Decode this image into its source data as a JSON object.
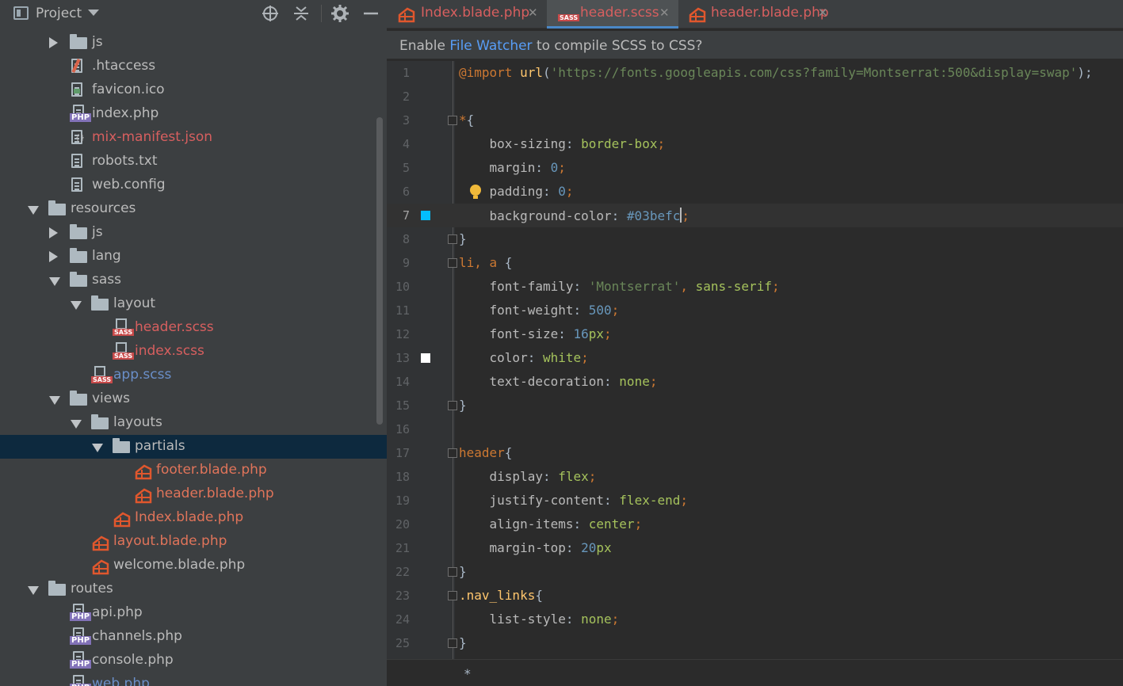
{
  "project_panel": {
    "title": "Project",
    "icons": [
      "window-icon",
      "chevron-down-icon",
      "locate-icon",
      "collapse-all-icon",
      "gear-icon",
      "minimize-icon"
    ],
    "tree": [
      {
        "label": "js",
        "type": "folder",
        "state": "collapsed",
        "color": "normal"
      },
      {
        "label": ".htaccess",
        "type": "file-htaccess",
        "color": "normal"
      },
      {
        "label": "favicon.ico",
        "type": "file-image",
        "color": "normal"
      },
      {
        "label": "index.php",
        "type": "file-php",
        "color": "normal"
      },
      {
        "label": "mix-manifest.json",
        "type": "file-json",
        "color": "red"
      },
      {
        "label": "robots.txt",
        "type": "file-text",
        "color": "normal"
      },
      {
        "label": "web.config",
        "type": "file-text",
        "color": "normal"
      },
      {
        "label": "resources",
        "type": "folder",
        "state": "expanded",
        "color": "normal"
      },
      {
        "label": "js",
        "type": "folder",
        "state": "collapsed",
        "color": "normal"
      },
      {
        "label": "lang",
        "type": "folder",
        "state": "collapsed",
        "color": "normal"
      },
      {
        "label": "sass",
        "type": "folder",
        "state": "expanded",
        "color": "normal"
      },
      {
        "label": "layout",
        "type": "folder",
        "state": "expanded",
        "color": "normal"
      },
      {
        "label": "header.scss",
        "type": "file-sass",
        "color": "red"
      },
      {
        "label": "index.scss",
        "type": "file-sass",
        "color": "red"
      },
      {
        "label": "app.scss",
        "type": "file-sass",
        "color": "blue"
      },
      {
        "label": "views",
        "type": "folder",
        "state": "expanded",
        "color": "normal"
      },
      {
        "label": "layouts",
        "type": "folder",
        "state": "expanded",
        "color": "normal"
      },
      {
        "label": "partials",
        "type": "folder",
        "state": "expanded",
        "color": "normal",
        "selected": true
      },
      {
        "label": "footer.blade.php",
        "type": "file-blade",
        "color": "orange"
      },
      {
        "label": "header.blade.php",
        "type": "file-blade",
        "color": "orange"
      },
      {
        "label": "Index.blade.php",
        "type": "file-blade",
        "color": "orange"
      },
      {
        "label": "layout.blade.php",
        "type": "file-blade",
        "color": "orange"
      },
      {
        "label": "welcome.blade.php",
        "type": "file-blade",
        "color": "normal"
      },
      {
        "label": "routes",
        "type": "folder",
        "state": "expanded",
        "color": "normal"
      },
      {
        "label": "api.php",
        "type": "file-php",
        "color": "normal"
      },
      {
        "label": "channels.php",
        "type": "file-php",
        "color": "normal"
      },
      {
        "label": "console.php",
        "type": "file-php",
        "color": "normal"
      },
      {
        "label": "web.php",
        "type": "file-php",
        "color": "blue"
      }
    ]
  },
  "tabs": [
    {
      "label": "Index.blade.php",
      "icon": "blade-icon",
      "active": false
    },
    {
      "label": "header.scss",
      "icon": "sass-icon",
      "active": true
    },
    {
      "label": "header.blade.php",
      "icon": "blade-icon",
      "active": false
    }
  ],
  "tab_close_glyph": "✕",
  "banner": {
    "prefix": "Enable ",
    "link": "File Watcher",
    "suffix": " to compile SCSS to CSS?"
  },
  "code_lines": [
    {
      "n": "1",
      "tokens": [
        [
          "imp",
          "@import"
        ],
        [
          "id",
          " "
        ],
        [
          "fn",
          "url"
        ],
        [
          "id",
          "("
        ],
        [
          "str",
          "'https://fonts.googleapis.com/css?family=Montserrat:500&display=swap'"
        ],
        [
          "id",
          ");"
        ]
      ]
    },
    {
      "n": "2",
      "tokens": []
    },
    {
      "n": "3",
      "tokens": [
        [
          "sel",
          "*"
        ],
        [
          "id",
          "{"
        ]
      ],
      "fold": true
    },
    {
      "n": "4",
      "tokens": [
        [
          "id",
          "    "
        ],
        [
          "prop",
          "box-sizing"
        ],
        [
          "id",
          ": "
        ],
        [
          "val",
          "border-box"
        ],
        [
          "sel",
          ";"
        ]
      ]
    },
    {
      "n": "5",
      "tokens": [
        [
          "id",
          "    "
        ],
        [
          "prop",
          "margin"
        ],
        [
          "id",
          ": "
        ],
        [
          "num",
          "0"
        ],
        [
          "sel",
          ";"
        ]
      ]
    },
    {
      "n": "6",
      "tokens": [
        [
          "id",
          "    "
        ],
        [
          "prop",
          "padding"
        ],
        [
          "id",
          ": "
        ],
        [
          "num",
          "0"
        ],
        [
          "sel",
          ";"
        ]
      ],
      "bulb": true
    },
    {
      "n": "7",
      "tokens": [
        [
          "id",
          "    "
        ],
        [
          "prop",
          "background-color"
        ],
        [
          "id",
          ": "
        ],
        [
          "num",
          "#03befc"
        ],
        [
          "caret",
          ""
        ],
        [
          "sel",
          ";"
        ]
      ],
      "current": true,
      "swatch": "#03befc"
    },
    {
      "n": "8",
      "tokens": [
        [
          "id",
          "}"
        ]
      ],
      "fold": true
    },
    {
      "n": "9",
      "tokens": [
        [
          "sel",
          "li, a "
        ],
        [
          "id",
          "{"
        ]
      ],
      "fold": true
    },
    {
      "n": "10",
      "tokens": [
        [
          "id",
          "    "
        ],
        [
          "prop",
          "font-family"
        ],
        [
          "id",
          ": "
        ],
        [
          "str",
          "'Montserrat'"
        ],
        [
          "sel",
          ", "
        ],
        [
          "val",
          "sans-serif"
        ],
        [
          "sel",
          ";"
        ]
      ]
    },
    {
      "n": "11",
      "tokens": [
        [
          "id",
          "    "
        ],
        [
          "prop",
          "font-weight"
        ],
        [
          "id",
          ": "
        ],
        [
          "num",
          "500"
        ],
        [
          "sel",
          ";"
        ]
      ]
    },
    {
      "n": "12",
      "tokens": [
        [
          "id",
          "    "
        ],
        [
          "prop",
          "font-size"
        ],
        [
          "id",
          ": "
        ],
        [
          "num",
          "16"
        ],
        [
          "val",
          "px"
        ],
        [
          "sel",
          ";"
        ]
      ]
    },
    {
      "n": "13",
      "tokens": [
        [
          "id",
          "    "
        ],
        [
          "prop",
          "color"
        ],
        [
          "id",
          ": "
        ],
        [
          "val",
          "white"
        ],
        [
          "sel",
          ";"
        ]
      ],
      "swatch": "#ffffff"
    },
    {
      "n": "14",
      "tokens": [
        [
          "id",
          "    "
        ],
        [
          "prop",
          "text-decoration"
        ],
        [
          "id",
          ": "
        ],
        [
          "val",
          "none"
        ],
        [
          "sel",
          ";"
        ]
      ]
    },
    {
      "n": "15",
      "tokens": [
        [
          "id",
          "}"
        ]
      ],
      "fold": true
    },
    {
      "n": "16",
      "tokens": []
    },
    {
      "n": "17",
      "tokens": [
        [
          "sel",
          "header"
        ],
        [
          "id",
          "{"
        ]
      ],
      "fold": true
    },
    {
      "n": "18",
      "tokens": [
        [
          "id",
          "    "
        ],
        [
          "prop",
          "display"
        ],
        [
          "id",
          ": "
        ],
        [
          "val",
          "flex"
        ],
        [
          "sel",
          ";"
        ]
      ]
    },
    {
      "n": "19",
      "tokens": [
        [
          "id",
          "    "
        ],
        [
          "prop",
          "justify-content"
        ],
        [
          "id",
          ": "
        ],
        [
          "val",
          "flex-end"
        ],
        [
          "sel",
          ";"
        ]
      ]
    },
    {
      "n": "20",
      "tokens": [
        [
          "id",
          "    "
        ],
        [
          "prop",
          "align-items"
        ],
        [
          "id",
          ": "
        ],
        [
          "val",
          "center"
        ],
        [
          "sel",
          ";"
        ]
      ]
    },
    {
      "n": "21",
      "tokens": [
        [
          "id",
          "    "
        ],
        [
          "prop",
          "margin-top"
        ],
        [
          "id",
          ": "
        ],
        [
          "num",
          "20"
        ],
        [
          "val",
          "px"
        ]
      ]
    },
    {
      "n": "22",
      "tokens": [
        [
          "id",
          "}"
        ]
      ],
      "fold": true
    },
    {
      "n": "23",
      "tokens": [
        [
          "fn",
          ".nav_links"
        ],
        [
          "id",
          "{"
        ]
      ],
      "fold": true
    },
    {
      "n": "24",
      "tokens": [
        [
          "id",
          "    "
        ],
        [
          "prop",
          "list-style"
        ],
        [
          "id",
          ": "
        ],
        [
          "val",
          "none"
        ],
        [
          "sel",
          ";"
        ]
      ]
    },
    {
      "n": "25",
      "tokens": [
        [
          "id",
          "}"
        ]
      ],
      "fold": true
    }
  ],
  "breadcrumb": "*",
  "colors": {
    "accent": "#4a88c7",
    "link": "#589df6",
    "selection": "#0d293e"
  }
}
